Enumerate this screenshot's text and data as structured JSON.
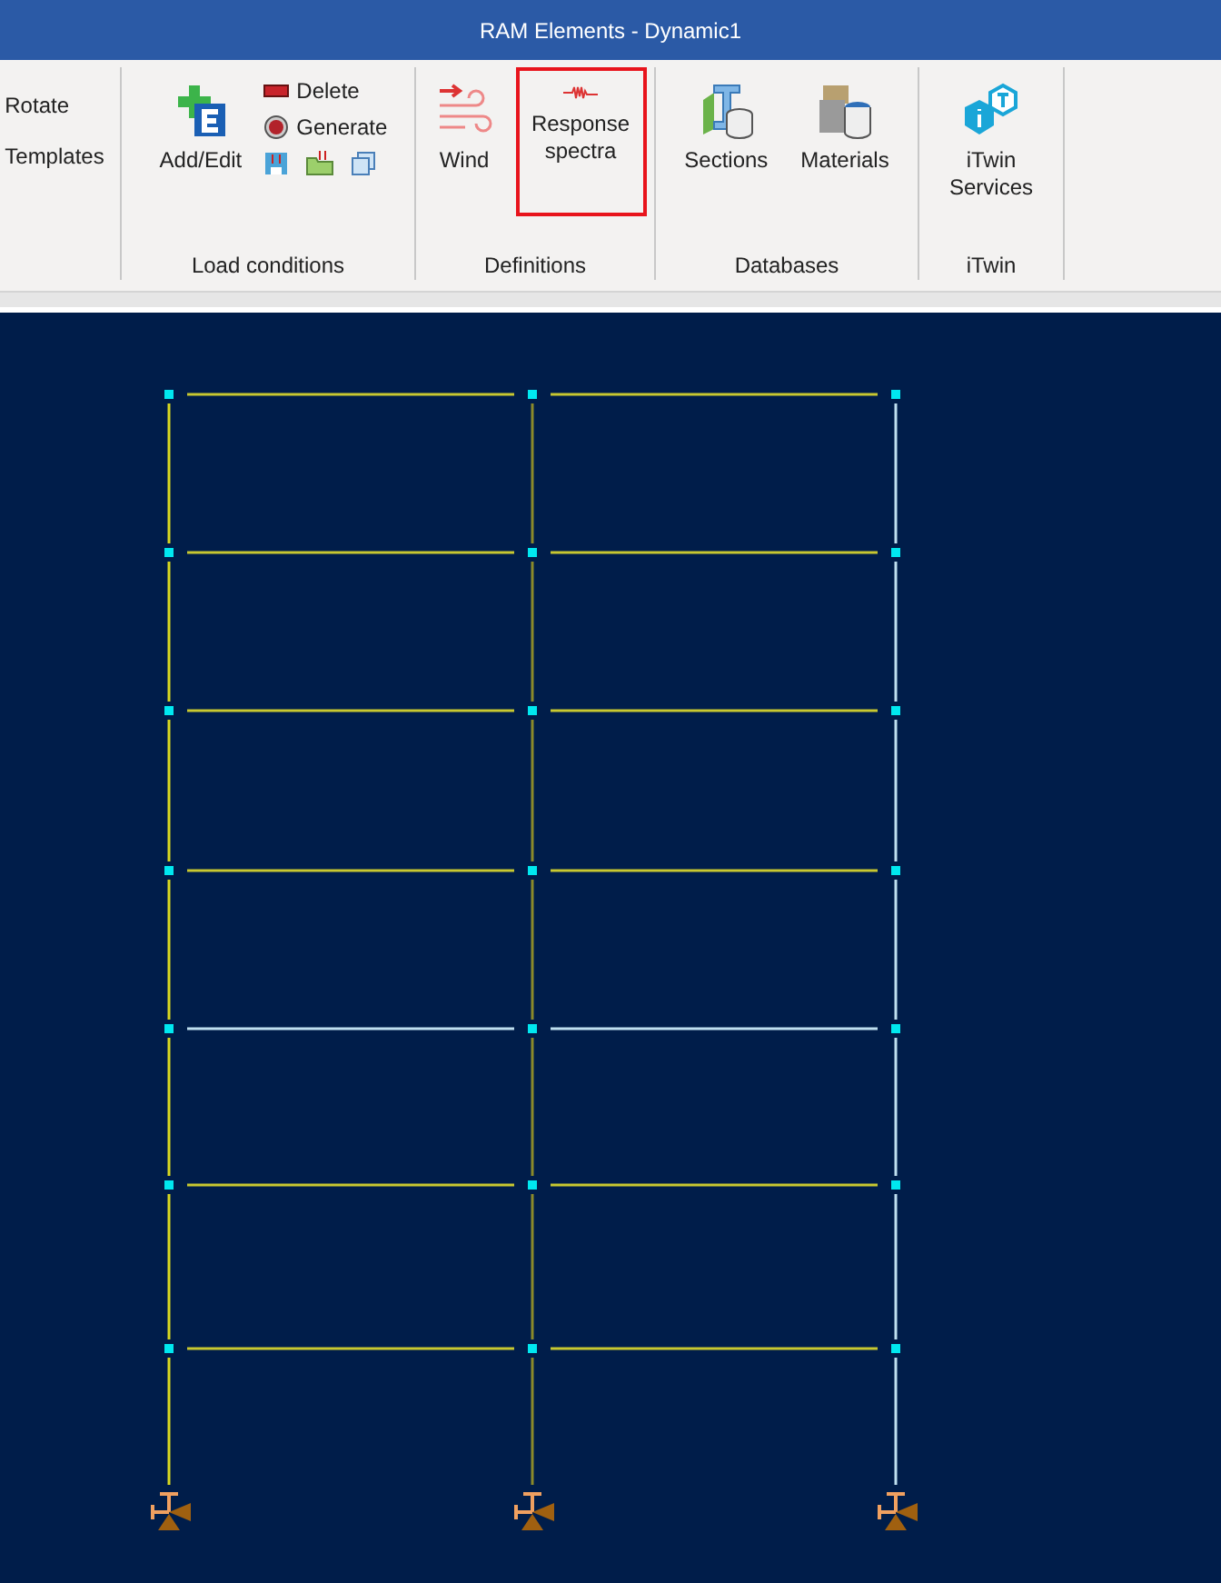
{
  "window": {
    "title": "RAM Elements - Dynamic1"
  },
  "ribbon": {
    "groups": [
      {
        "items": [
          {
            "kind": "text",
            "label": "Rotate"
          },
          {
            "kind": "text",
            "label": "Templates"
          }
        ]
      },
      {
        "label": "Load conditions",
        "items": [
          {
            "kind": "large",
            "label": "Add/Edit",
            "highlighted": false
          },
          {
            "kind": "small",
            "label": "Delete"
          },
          {
            "kind": "small",
            "label": "Generate"
          },
          {
            "kind": "mini"
          },
          {
            "kind": "mini"
          },
          {
            "kind": "mini"
          }
        ]
      },
      {
        "label": "Definitions",
        "items": [
          {
            "kind": "large",
            "label": "Wind",
            "highlighted": false
          },
          {
            "kind": "large",
            "label": "Response spectra",
            "highlighted": true
          }
        ]
      },
      {
        "label": "Databases",
        "items": [
          {
            "kind": "large",
            "label": "Sections",
            "highlighted": false
          },
          {
            "kind": "large",
            "label": "Materials",
            "highlighted": false
          }
        ]
      },
      {
        "label": "iTwin",
        "items": [
          {
            "kind": "large",
            "label": "iTwin Services",
            "highlighted": false
          }
        ]
      }
    ]
  }
}
